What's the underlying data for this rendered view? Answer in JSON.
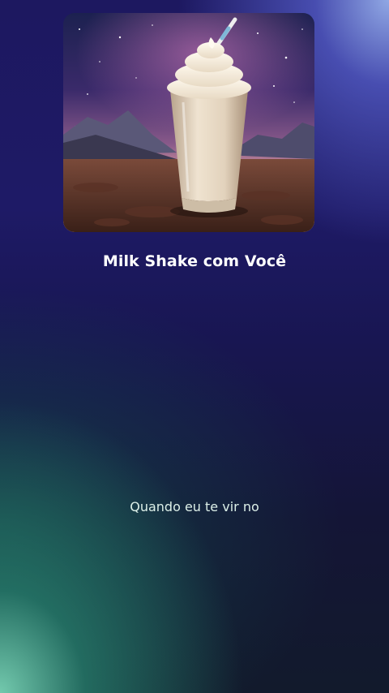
{
  "track": {
    "title": "Milk Shake com Você",
    "artwork": "milkshake-night-sky-artwork"
  },
  "lyrics": {
    "current_line": "Quando eu te vir no"
  },
  "colors": {
    "background_top": "#1e1a66",
    "background_glow_top_right": "#96afeb",
    "background_glow_bottom_left": "#78d2b4",
    "title_text": "#ffffff",
    "lyric_text": "#dcefe8"
  }
}
